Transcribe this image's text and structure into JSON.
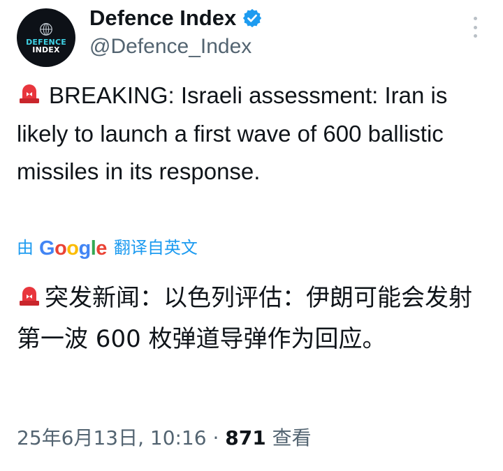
{
  "author": {
    "display_name": "Defence Index",
    "handle": "@Defence_Index",
    "verified": true,
    "avatar_text_top": "DEFENCE",
    "avatar_text_bottom": "INDEX"
  },
  "post": {
    "icon": "police-siren-icon",
    "text": "BREAKING: Israeli assessment: Iran is likely to launch a first wave of 600 ballistic missiles in its response."
  },
  "translation": {
    "by_label": "由",
    "google_letters": [
      "G",
      "o",
      "o",
      "g",
      "l",
      "e"
    ],
    "from_label": "翻译自英文",
    "text": "突发新闻：以色列评估：伊朗可能会发射第一波 600 枚弹道导弹作为回应。"
  },
  "meta": {
    "timestamp": "25年6月13日, 10:16",
    "separator": "·",
    "views_count": "871",
    "views_label": "查看"
  },
  "colors": {
    "link": "#1d9bf0",
    "muted": "#536471",
    "text": "#0f1419",
    "verified": "#1d9bf0",
    "avatar_bg": "#0d1117",
    "avatar_accent": "#3fd3e6"
  }
}
